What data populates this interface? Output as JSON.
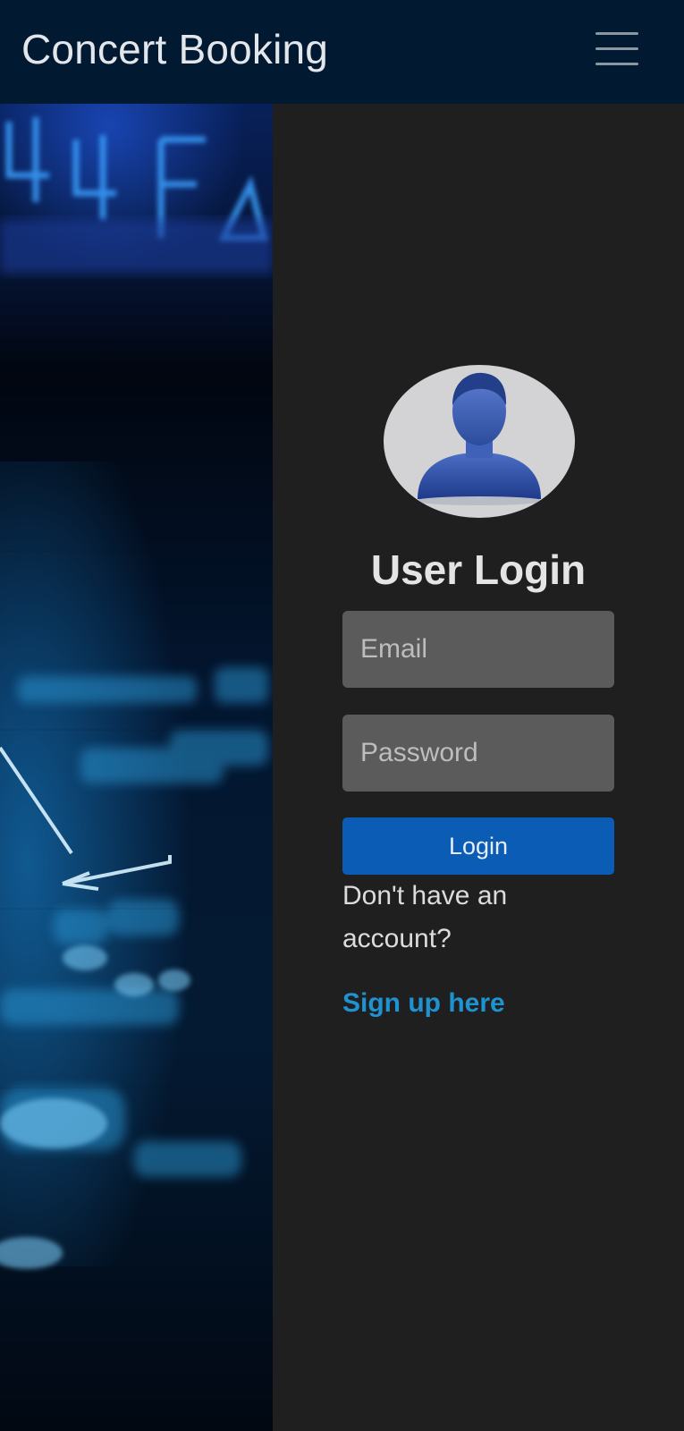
{
  "navbar": {
    "brand": "Concert Booking",
    "menu_icon": "hamburger-menu-icon",
    "background": "#011931"
  },
  "hero": {
    "image_text": "44F"
  },
  "login": {
    "avatar_icon": "user-avatar-icon",
    "title": "User Login",
    "email_placeholder": "Email",
    "password_placeholder": "Password",
    "submit_label": "Login",
    "no_account_text": "Don't have an account?",
    "signup_label": "Sign up here"
  },
  "colors": {
    "panel_background": "#1f1f1f",
    "input_background": "#5b5b5b",
    "button_primary": "#0b5cb4",
    "link": "#1f93d2"
  }
}
